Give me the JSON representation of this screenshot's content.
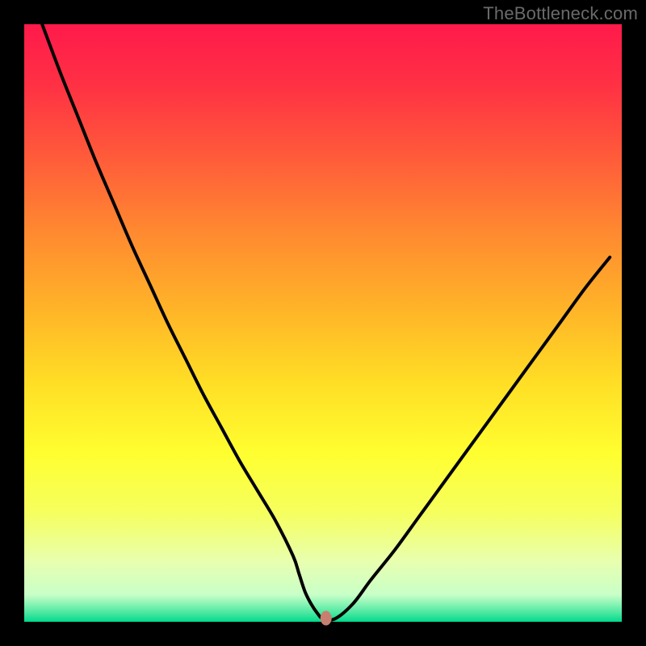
{
  "watermark": "TheBottleneck.com",
  "chart_data": {
    "type": "line",
    "title": "",
    "xlabel": "",
    "ylabel": "",
    "xlim": [
      0,
      100
    ],
    "ylim": [
      0,
      100
    ],
    "grid": false,
    "legend": false,
    "x": [
      3,
      6,
      9,
      12,
      15,
      18,
      21,
      24,
      27,
      30,
      33,
      36,
      39,
      42,
      45,
      46,
      47,
      48,
      49,
      50,
      52,
      55,
      58,
      62,
      66,
      70,
      74,
      78,
      82,
      86,
      90,
      94,
      98
    ],
    "y": [
      100,
      92,
      84.5,
      77,
      70,
      63,
      56.5,
      50,
      44,
      38,
      32.5,
      27,
      22,
      17,
      11,
      8,
      5,
      3,
      1.5,
      0.5,
      0.5,
      3,
      7,
      12,
      17.5,
      23,
      28.5,
      34,
      39.5,
      45,
      50.5,
      56,
      61
    ],
    "marker": {
      "x": 50.5,
      "y": 0.6
    },
    "annotations": []
  },
  "plot": {
    "inner_x": 30,
    "inner_y": 30,
    "inner_w": 740,
    "inner_h": 740,
    "gradient_stops": [
      {
        "offset": 0.0,
        "color": "#ff1a4b"
      },
      {
        "offset": 0.1,
        "color": "#ff3044"
      },
      {
        "offset": 0.22,
        "color": "#ff5a3a"
      },
      {
        "offset": 0.35,
        "color": "#ff8a30"
      },
      {
        "offset": 0.48,
        "color": "#ffb528"
      },
      {
        "offset": 0.6,
        "color": "#ffde25"
      },
      {
        "offset": 0.72,
        "color": "#ffff30"
      },
      {
        "offset": 0.82,
        "color": "#f5ff60"
      },
      {
        "offset": 0.9,
        "color": "#e8ffb0"
      },
      {
        "offset": 0.955,
        "color": "#c8ffc8"
      },
      {
        "offset": 0.985,
        "color": "#4be8a0"
      },
      {
        "offset": 1.0,
        "color": "#00d98c"
      }
    ],
    "marker_color": "#c97f6f",
    "curve_color": "#000000",
    "curve_width": 4
  }
}
